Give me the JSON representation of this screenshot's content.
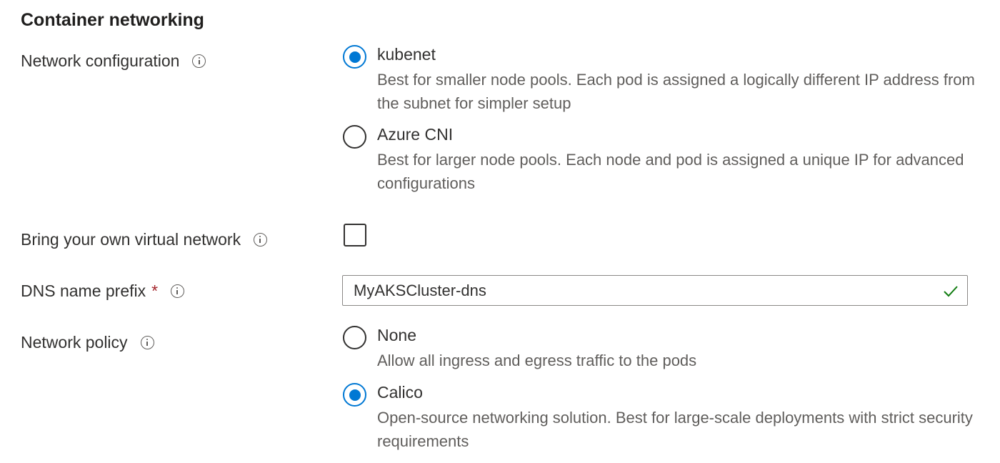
{
  "section_title": "Container networking",
  "network_configuration": {
    "label": "Network configuration",
    "info_icon": "info-icon",
    "options": [
      {
        "title": "kubenet",
        "description": "Best for smaller node pools. Each pod is assigned a logically different IP address from the subnet for simpler setup",
        "selected": true
      },
      {
        "title": "Azure CNI",
        "description": "Best for larger node pools. Each node and pod is assigned a unique IP for advanced configurations",
        "selected": false
      }
    ]
  },
  "bring_own_vnet": {
    "label": "Bring your own virtual network",
    "checked": false
  },
  "dns_prefix": {
    "label": "DNS name prefix",
    "required_marker": "*",
    "value": "MyAKSCluster-dns",
    "valid": true
  },
  "network_policy": {
    "label": "Network policy",
    "options": [
      {
        "title": "None",
        "description": "Allow all ingress and egress traffic to the pods",
        "selected": false
      },
      {
        "title": "Calico",
        "description": "Open-source networking solution. Best for large-scale deployments with strict security requirements",
        "selected": true
      }
    ]
  },
  "colors": {
    "accent": "#0078d4",
    "required": "#a4262c",
    "valid": "#107c10",
    "text": "#323130",
    "secondary_text": "#605e5c"
  }
}
